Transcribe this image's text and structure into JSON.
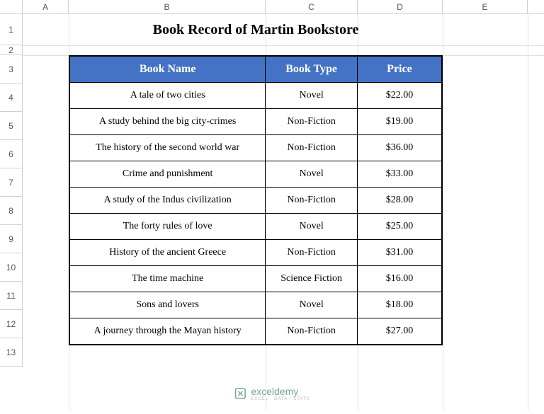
{
  "columns": [
    "A",
    "B",
    "C",
    "D",
    "E"
  ],
  "rows": [
    "1",
    "2",
    "3",
    "4",
    "5",
    "6",
    "7",
    "8",
    "9",
    "10",
    "11",
    "12",
    "13"
  ],
  "title": "Book Record of Martin Bookstore",
  "headers": {
    "name": "Book Name",
    "type": "Book Type",
    "price": "Price"
  },
  "books": [
    {
      "name": "A tale of two cities",
      "type": "Novel",
      "price": "$22.00"
    },
    {
      "name": "A study behind the big city-crimes",
      "type": "Non-Fiction",
      "price": "$19.00"
    },
    {
      "name": "The history of the second world war",
      "type": "Non-Fiction",
      "price": "$36.00"
    },
    {
      "name": "Crime and punishment",
      "type": "Novel",
      "price": "$33.00"
    },
    {
      "name": "A study of the Indus civilization",
      "type": "Non-Fiction",
      "price": "$28.00"
    },
    {
      "name": "The forty rules of love",
      "type": "Novel",
      "price": "$25.00"
    },
    {
      "name": "History of the ancient Greece",
      "type": "Non-Fiction",
      "price": "$31.00"
    },
    {
      "name": "The time machine",
      "type": "Science Fiction",
      "price": "$16.00"
    },
    {
      "name": "Sons and lovers",
      "type": "Novel",
      "price": "$18.00"
    },
    {
      "name": "A journey through the Mayan history",
      "type": "Non-Fiction",
      "price": "$27.00"
    }
  ],
  "watermark": {
    "brand": "exceldemy",
    "tagline": "EXCEL · DATA · STATS"
  },
  "chart_data": {
    "type": "table",
    "title": "Book Record of Martin Bookstore",
    "columns": [
      "Book Name",
      "Book Type",
      "Price"
    ],
    "rows": [
      [
        "A tale of two cities",
        "Novel",
        22.0
      ],
      [
        "A study behind the big city-crimes",
        "Non-Fiction",
        19.0
      ],
      [
        "The history of the second world war",
        "Non-Fiction",
        36.0
      ],
      [
        "Crime and punishment",
        "Novel",
        33.0
      ],
      [
        "A study of the Indus civilization",
        "Non-Fiction",
        28.0
      ],
      [
        "The forty rules of love",
        "Novel",
        25.0
      ],
      [
        "History of the ancient Greece",
        "Non-Fiction",
        31.0
      ],
      [
        "The time machine",
        "Science Fiction",
        16.0
      ],
      [
        "Sons and lovers",
        "Novel",
        18.0
      ],
      [
        "A journey through the Mayan history",
        "Non-Fiction",
        27.0
      ]
    ]
  }
}
